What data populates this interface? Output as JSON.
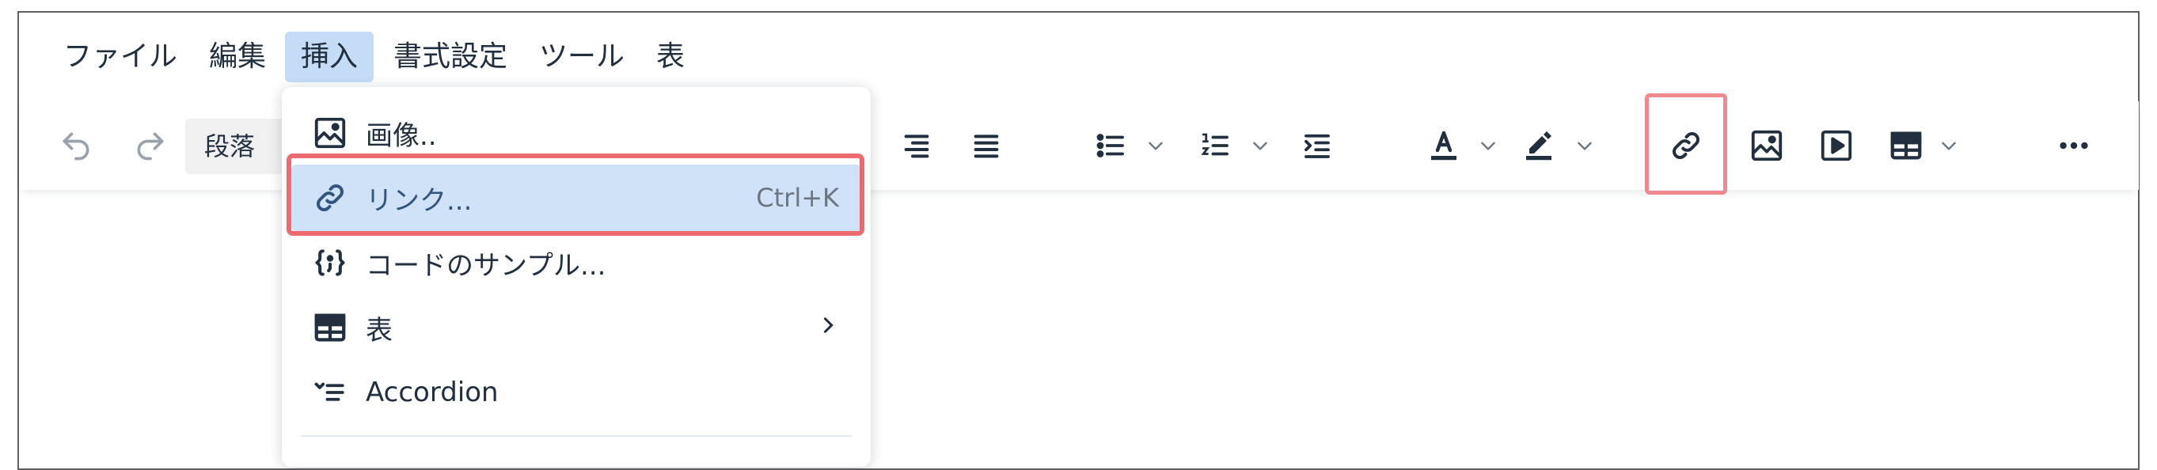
{
  "menubar": {
    "items": [
      {
        "label": "ファイル"
      },
      {
        "label": "編集"
      },
      {
        "label": "挿入"
      },
      {
        "label": "書式設定"
      },
      {
        "label": "ツール"
      },
      {
        "label": "表"
      }
    ],
    "active_index": 2
  },
  "toolbar": {
    "block_format": "段落",
    "icons": [
      "undo-icon",
      "redo-icon",
      "align-right-icon",
      "align-justify-icon",
      "bullet-list-icon",
      "numbered-list-icon",
      "indent-icon",
      "text-color-icon",
      "highlight-color-icon",
      "link-icon",
      "image-icon",
      "media-icon",
      "table-icon",
      "more-icon"
    ]
  },
  "insert_menu": {
    "items": [
      {
        "label": "画像..",
        "icon": "image-icon"
      },
      {
        "label": "リンク...",
        "icon": "link-icon",
        "shortcut": "Ctrl+K",
        "active": true
      },
      {
        "label": "コードのサンプル...",
        "icon": "code-sample-icon"
      },
      {
        "label": "表",
        "icon": "table-icon",
        "submenu": true
      },
      {
        "label": "Accordion",
        "icon": "accordion-icon"
      }
    ]
  },
  "colors": {
    "menu_active_bg": "#c5dcf6",
    "item_active_bg": "#cfe2f8",
    "highlight_border": "#ec6b6f",
    "text": "#222f3e"
  }
}
